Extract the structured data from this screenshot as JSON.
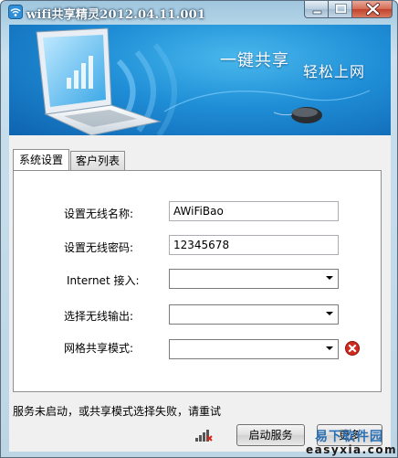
{
  "window": {
    "title": "wifi共享精灵2012.04.11.001"
  },
  "banner": {
    "slogan_primary": "一键共享",
    "slogan_secondary": "轻松上网"
  },
  "tabs": [
    {
      "label": "系统设置",
      "active": true
    },
    {
      "label": "客户列表",
      "active": false
    }
  ],
  "form": {
    "ssid_label": "设置无线名称:",
    "ssid_value": "AWiFiBao",
    "password_label": "设置无线密码:",
    "password_value": "12345678",
    "internet_label": "Internet 接入:",
    "internet_value": "",
    "wireless_out_label": "选择无线输出:",
    "wireless_out_value": "",
    "share_mode_label": "网格共享模式:",
    "share_mode_value": ""
  },
  "status_text": "服务未启动，或共享模式选择失败，请重试",
  "buttons": {
    "start_label": "启动服务",
    "more_label": "更多"
  },
  "watermark": {
    "line1": "易下软件园",
    "line2": "easyxia.com"
  },
  "colors": {
    "banner_blue": "#1f8ed6",
    "error_red": "#d12a1f"
  }
}
